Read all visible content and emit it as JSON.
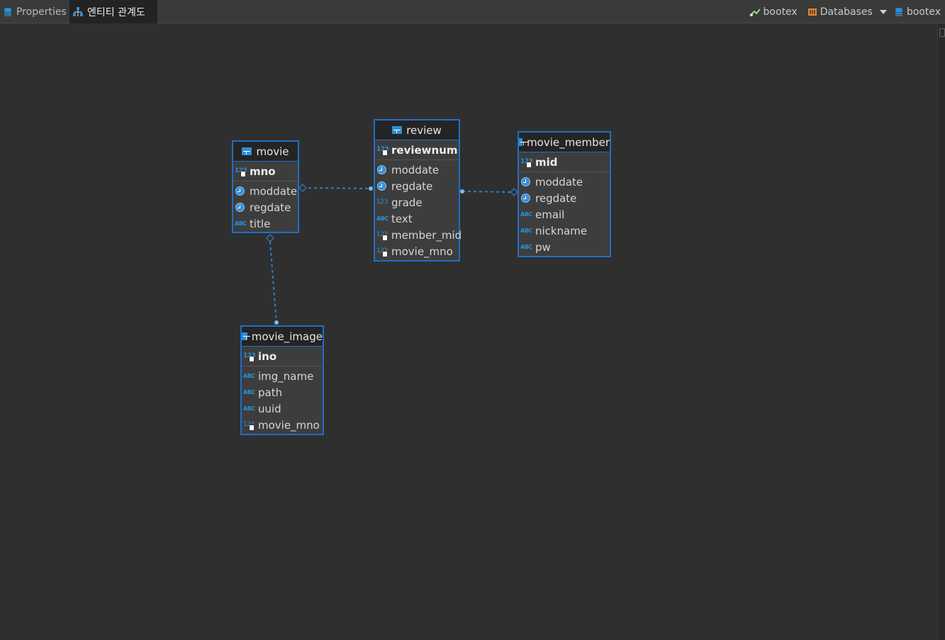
{
  "tabs": [
    {
      "label": "Properties",
      "icon": "database-icon",
      "active": false
    },
    {
      "label": "엔티티 관계도",
      "icon": "er-diagram-icon",
      "active": true
    }
  ],
  "toolbar": {
    "connection": "bootex",
    "databases": "Databases",
    "schema": "bootex"
  },
  "entities": {
    "movie": {
      "name": "movie",
      "pk": "mno",
      "columns": [
        {
          "name": "moddate",
          "type": "datetime"
        },
        {
          "name": "regdate",
          "type": "datetime"
        },
        {
          "name": "title",
          "type": "text"
        }
      ]
    },
    "review": {
      "name": "review",
      "pk": "reviewnum",
      "columns": [
        {
          "name": "moddate",
          "type": "datetime"
        },
        {
          "name": "regdate",
          "type": "datetime"
        },
        {
          "name": "grade",
          "type": "number"
        },
        {
          "name": "text",
          "type": "text"
        },
        {
          "name": "member_mid",
          "type": "fk-number"
        },
        {
          "name": "movie_mno",
          "type": "fk-number"
        }
      ]
    },
    "movie_member": {
      "name": "movie_member",
      "pk": "mid",
      "columns": [
        {
          "name": "moddate",
          "type": "datetime"
        },
        {
          "name": "regdate",
          "type": "datetime"
        },
        {
          "name": "email",
          "type": "text"
        },
        {
          "name": "nickname",
          "type": "text"
        },
        {
          "name": "pw",
          "type": "text"
        }
      ]
    },
    "movie_image": {
      "name": "movie_image",
      "pk": "ino",
      "columns": [
        {
          "name": "img_name",
          "type": "text"
        },
        {
          "name": "path",
          "type": "text"
        },
        {
          "name": "uuid",
          "type": "text"
        },
        {
          "name": "movie_mno",
          "type": "fk-number"
        }
      ]
    }
  },
  "relations": [
    {
      "from": "review",
      "to": "movie"
    },
    {
      "from": "review",
      "to": "movie_member"
    },
    {
      "from": "movie_image",
      "to": "movie"
    }
  ],
  "colors": {
    "accent": "#1f6fc4",
    "background": "#2f2f2f",
    "icon": "#2b8fd8"
  }
}
